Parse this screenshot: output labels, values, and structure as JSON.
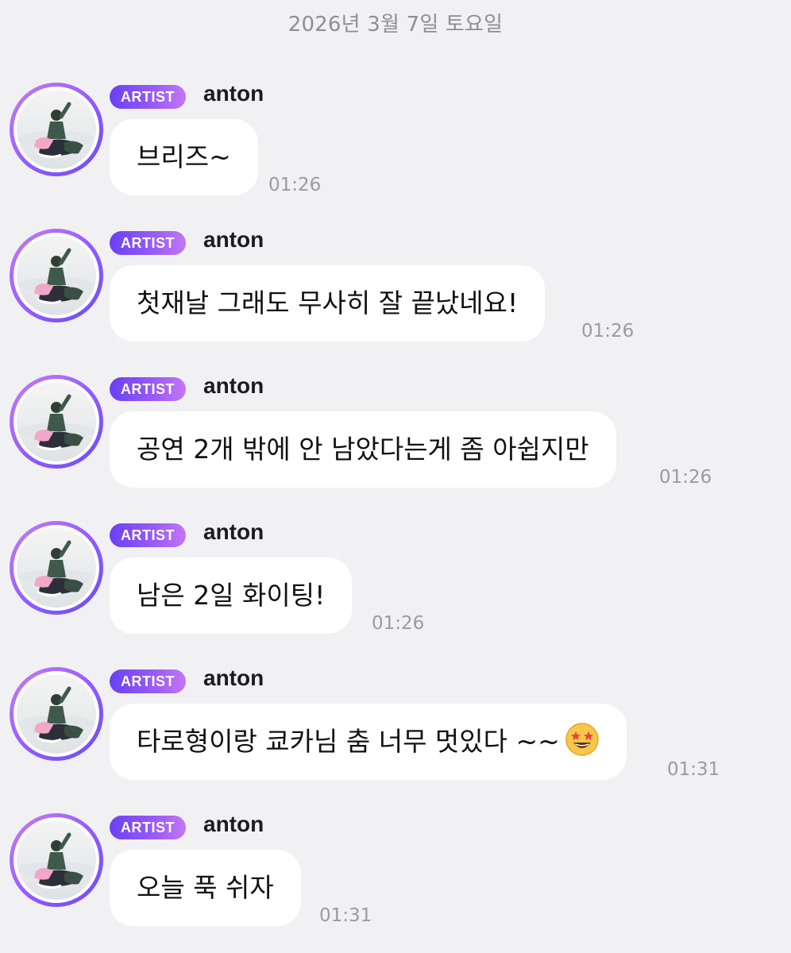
{
  "date_header": "2026년 3월 7일 토요일",
  "colors": {
    "background": "#f1f1f3",
    "bubble": "#ffffff",
    "badge_gradient_start": "#6a40f5",
    "badge_gradient_end": "#c476f4",
    "time_text": "#9a9aa0"
  },
  "messages": [
    {
      "badge": "ARTIST",
      "sender": "anton",
      "text": "브리즈~",
      "time": "01:26"
    },
    {
      "badge": "ARTIST",
      "sender": "anton",
      "text": "첫재날 그래도 무사히 잘 끝났네요!",
      "time": "01:26"
    },
    {
      "badge": "ARTIST",
      "sender": "anton",
      "text": "공연 2개 밖에 안 남았다는게 좀 아쉽지만",
      "time": "01:26"
    },
    {
      "badge": "ARTIST",
      "sender": "anton",
      "text": "남은 2일 화이팅!",
      "time": "01:26"
    },
    {
      "badge": "ARTIST",
      "sender": "anton",
      "text": "타로형이랑 쿄카님 춤 너무 멋있다 ~~",
      "time": "01:31",
      "emoji": "star-struck-emoji"
    },
    {
      "badge": "ARTIST",
      "sender": "anton",
      "text": "오늘 푹 쉬자",
      "time": "01:31"
    }
  ]
}
